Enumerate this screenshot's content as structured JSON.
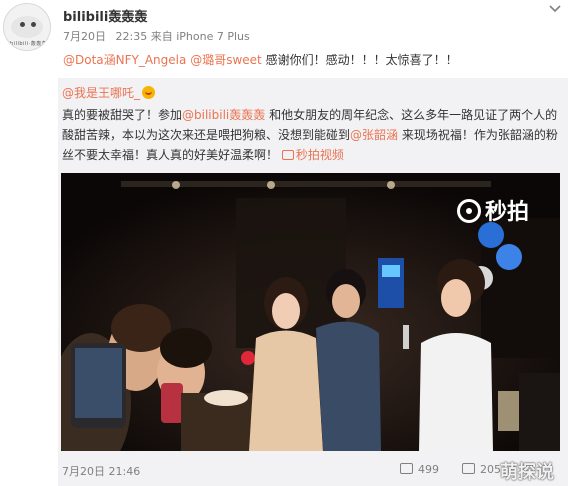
{
  "post": {
    "author": "bilibili轰轰轰",
    "date": "7月20日",
    "time": "22:35",
    "source_prefix": "来自",
    "source": "iPhone 7 Plus",
    "avatar_caption": "bilibili·轰轰轰",
    "text": {
      "mention1": "@Dota涵NFY_Angela",
      "mention2": "@璐哥sweet",
      "rest": " 感谢你们！感动！！！太惊喜了！！"
    }
  },
  "repost": {
    "author": "@我是王哪吒_",
    "emoji": "love-emoji",
    "line1": {
      "a": "真的要被甜哭了！参加",
      "mention": "@bilibili轰轰轰",
      "b": " 和他女朋友的周年纪念、这么多年一路见证了两个人的"
    },
    "line2": {
      "a": "酸甜苦辣，本以为这次来还是喂把狗粮、没想到能碰到",
      "mention": "@张韶涵",
      "b": " 来现场祝福！作为张韶涵的粉"
    },
    "line3": {
      "a": "丝不要太幸福！真人真的好美好温柔啊！",
      "video_link": "秒拍视频"
    },
    "video": {
      "watermark": "秒拍",
      "description": "party scene video frame"
    },
    "footer": {
      "date": "7月20日",
      "time": "21:46",
      "shares": "499",
      "comments": "205"
    }
  },
  "overlay": {
    "site_watermark": "萌探说"
  },
  "colors": {
    "link": "#eb7350",
    "repost_bg": "#f2f2f5",
    "meta": "#808080"
  }
}
